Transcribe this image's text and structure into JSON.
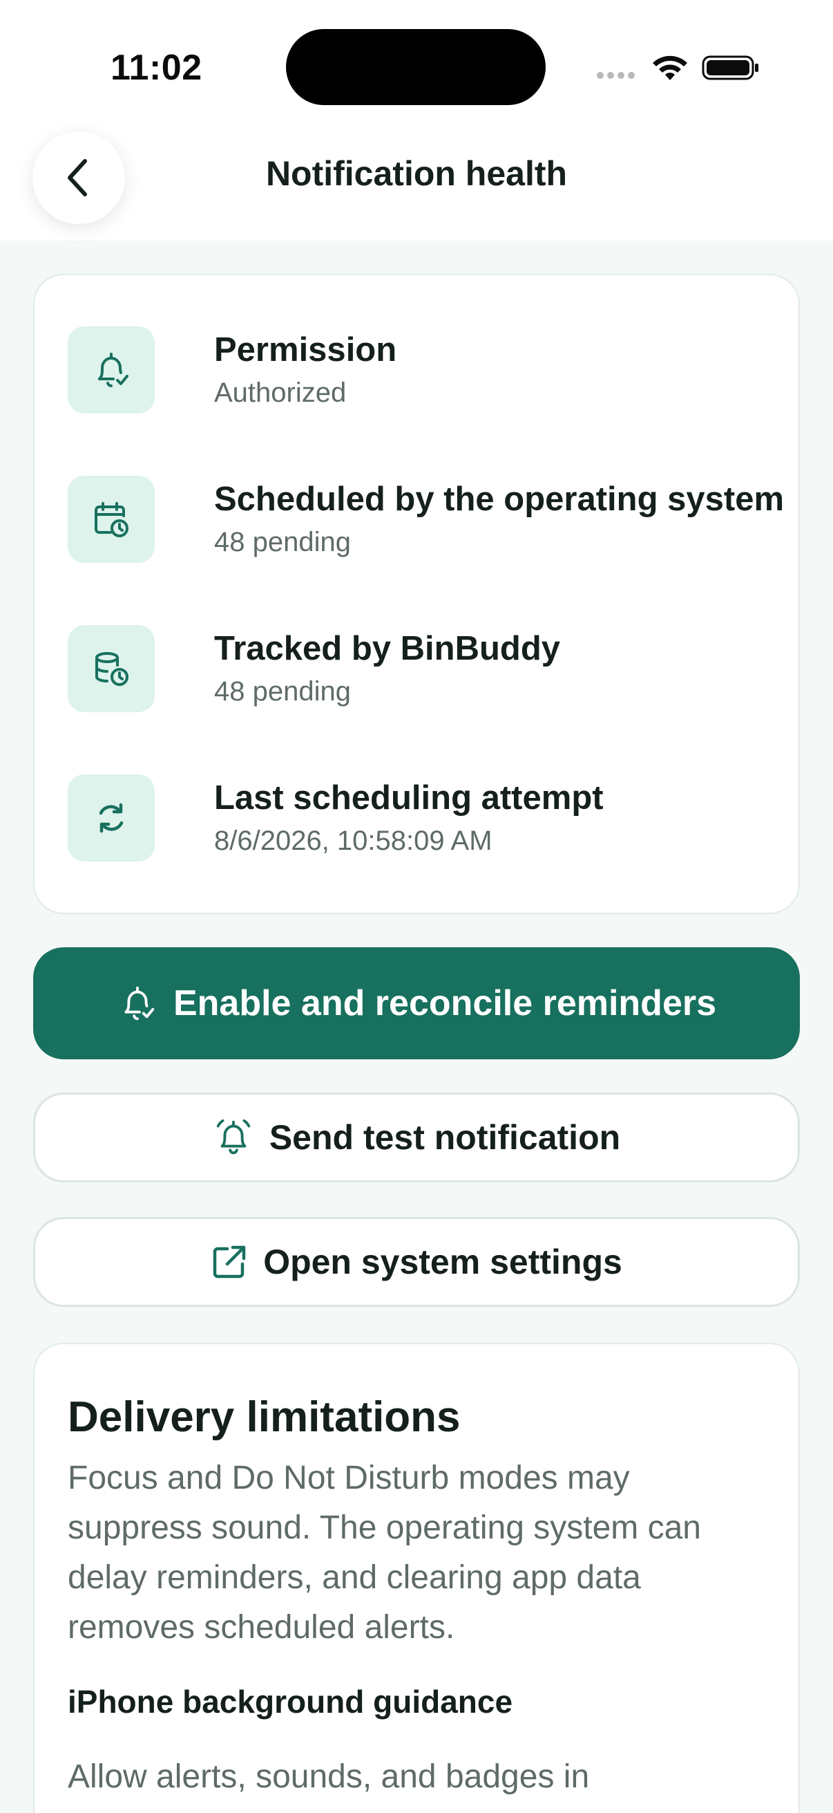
{
  "status_bar": {
    "time": "11:02"
  },
  "header": {
    "title": "Notification health"
  },
  "status_rows": [
    {
      "label": "Permission",
      "value": "Authorized",
      "icon": "bell-check-icon"
    },
    {
      "label": "Scheduled by the operating system",
      "value": "48 pending",
      "icon": "calendar-clock-icon"
    },
    {
      "label": "Tracked by BinBuddy",
      "value": "48 pending",
      "icon": "database-clock-icon"
    },
    {
      "label": "Last scheduling attempt",
      "value": "8/6/2026, 10:58:09 AM",
      "icon": "refresh-icon"
    }
  ],
  "actions": {
    "enable_label": "Enable and reconcile reminders",
    "test_label": "Send test notification",
    "settings_label": "Open system settings"
  },
  "info": {
    "title": "Delivery limitations",
    "body": "Focus and Do Not Disturb modes may suppress sound. The operating system can delay reminders, and clearing app data removes scheduled alerts.",
    "subtitle": "iPhone background guidance",
    "body2": "Allow alerts, sounds, and badges in"
  },
  "colors": {
    "accent": "#18705e",
    "icon_bg": "#ddf3ec",
    "background": "#f4f8f7"
  }
}
